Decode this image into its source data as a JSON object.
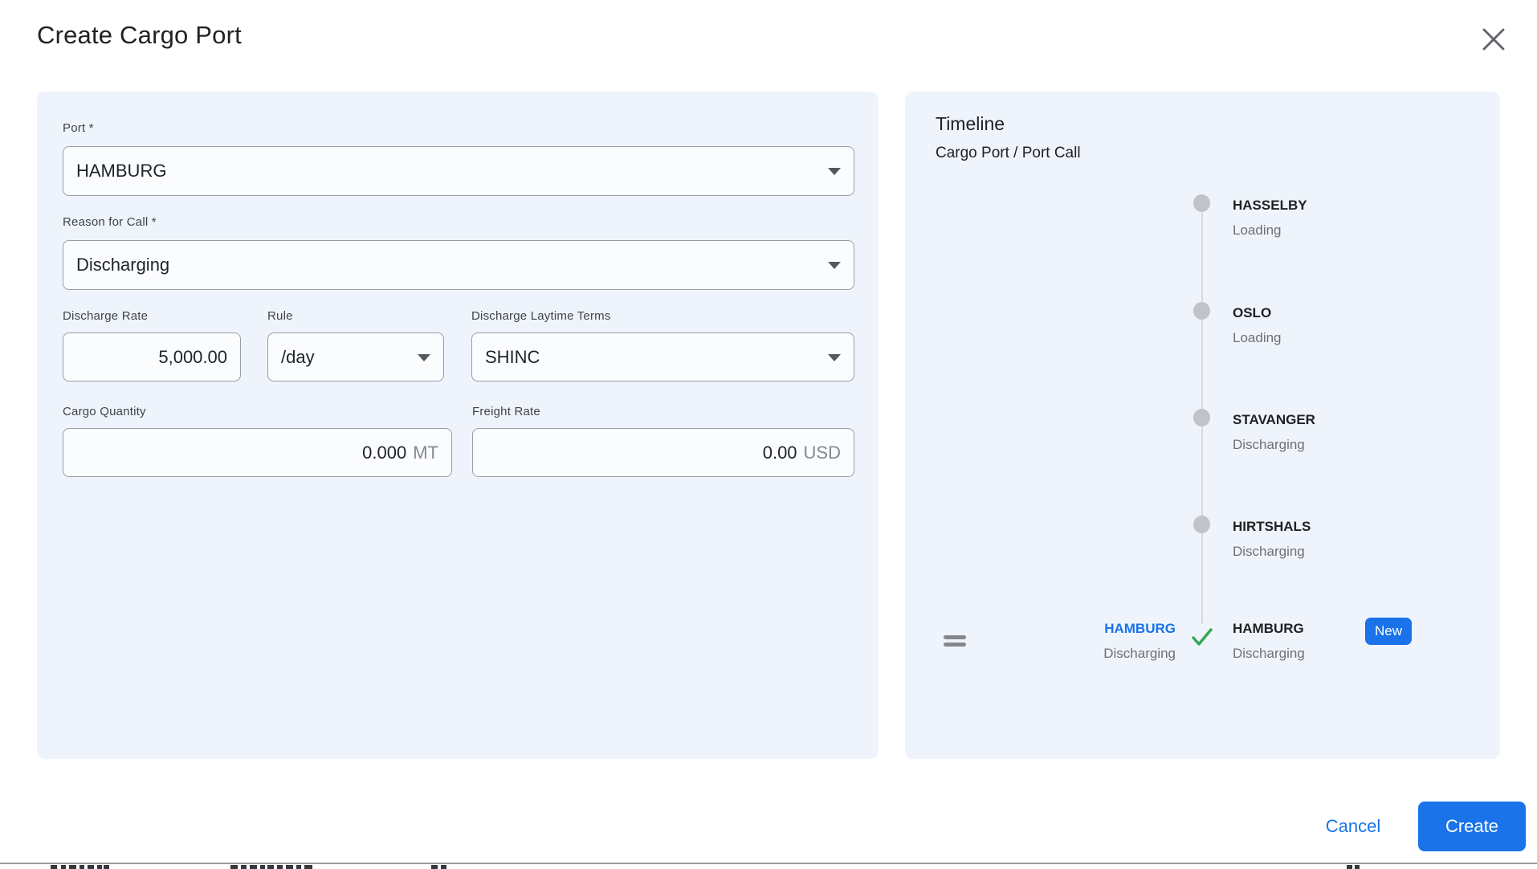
{
  "dialog": {
    "title": "Create Cargo Port"
  },
  "form": {
    "port": {
      "label": "Port *",
      "value": "HAMBURG"
    },
    "reason_for_call": {
      "label": "Reason for Call *",
      "value": "Discharging"
    },
    "discharge_rate": {
      "label": "Discharge Rate",
      "value": "5,000.00"
    },
    "rule": {
      "label": "Rule",
      "value": "/day"
    },
    "discharge_laytime_terms": {
      "label": "Discharge Laytime Terms",
      "value": "SHINC"
    },
    "cargo_quantity": {
      "label": "Cargo Quantity",
      "value": "0.000",
      "unit": "MT"
    },
    "freight_rate": {
      "label": "Freight Rate",
      "value": "0.00",
      "unit": "USD"
    }
  },
  "timeline": {
    "title": "Timeline",
    "subtitle": "Cargo Port / Port Call",
    "items": [
      {
        "port": "HASSELBY",
        "status": "Loading"
      },
      {
        "port": "OSLO",
        "status": "Loading"
      },
      {
        "port": "STAVANGER",
        "status": "Discharging"
      },
      {
        "port": "HIRTSHALS",
        "status": "Discharging"
      }
    ],
    "new_item": {
      "port": "HAMBURG",
      "status": "Discharging",
      "badge": "New"
    },
    "drag_preview": {
      "port": "HAMBURG",
      "status": "Discharging"
    }
  },
  "footer": {
    "cancel_label": "Cancel",
    "create_label": "Create"
  },
  "icons": {
    "close": "x-cross",
    "dropdown": "caret-down-triangle",
    "check": "green-checkmark",
    "drag": "double-bar-handle"
  },
  "colors": {
    "accent_blue": "#1a73e8",
    "success_green": "#34a853",
    "panel_bg": "#eff4fc",
    "field_border": "#989da4",
    "muted_text": "#6d7175",
    "badge_bg": "#1a73e8"
  }
}
